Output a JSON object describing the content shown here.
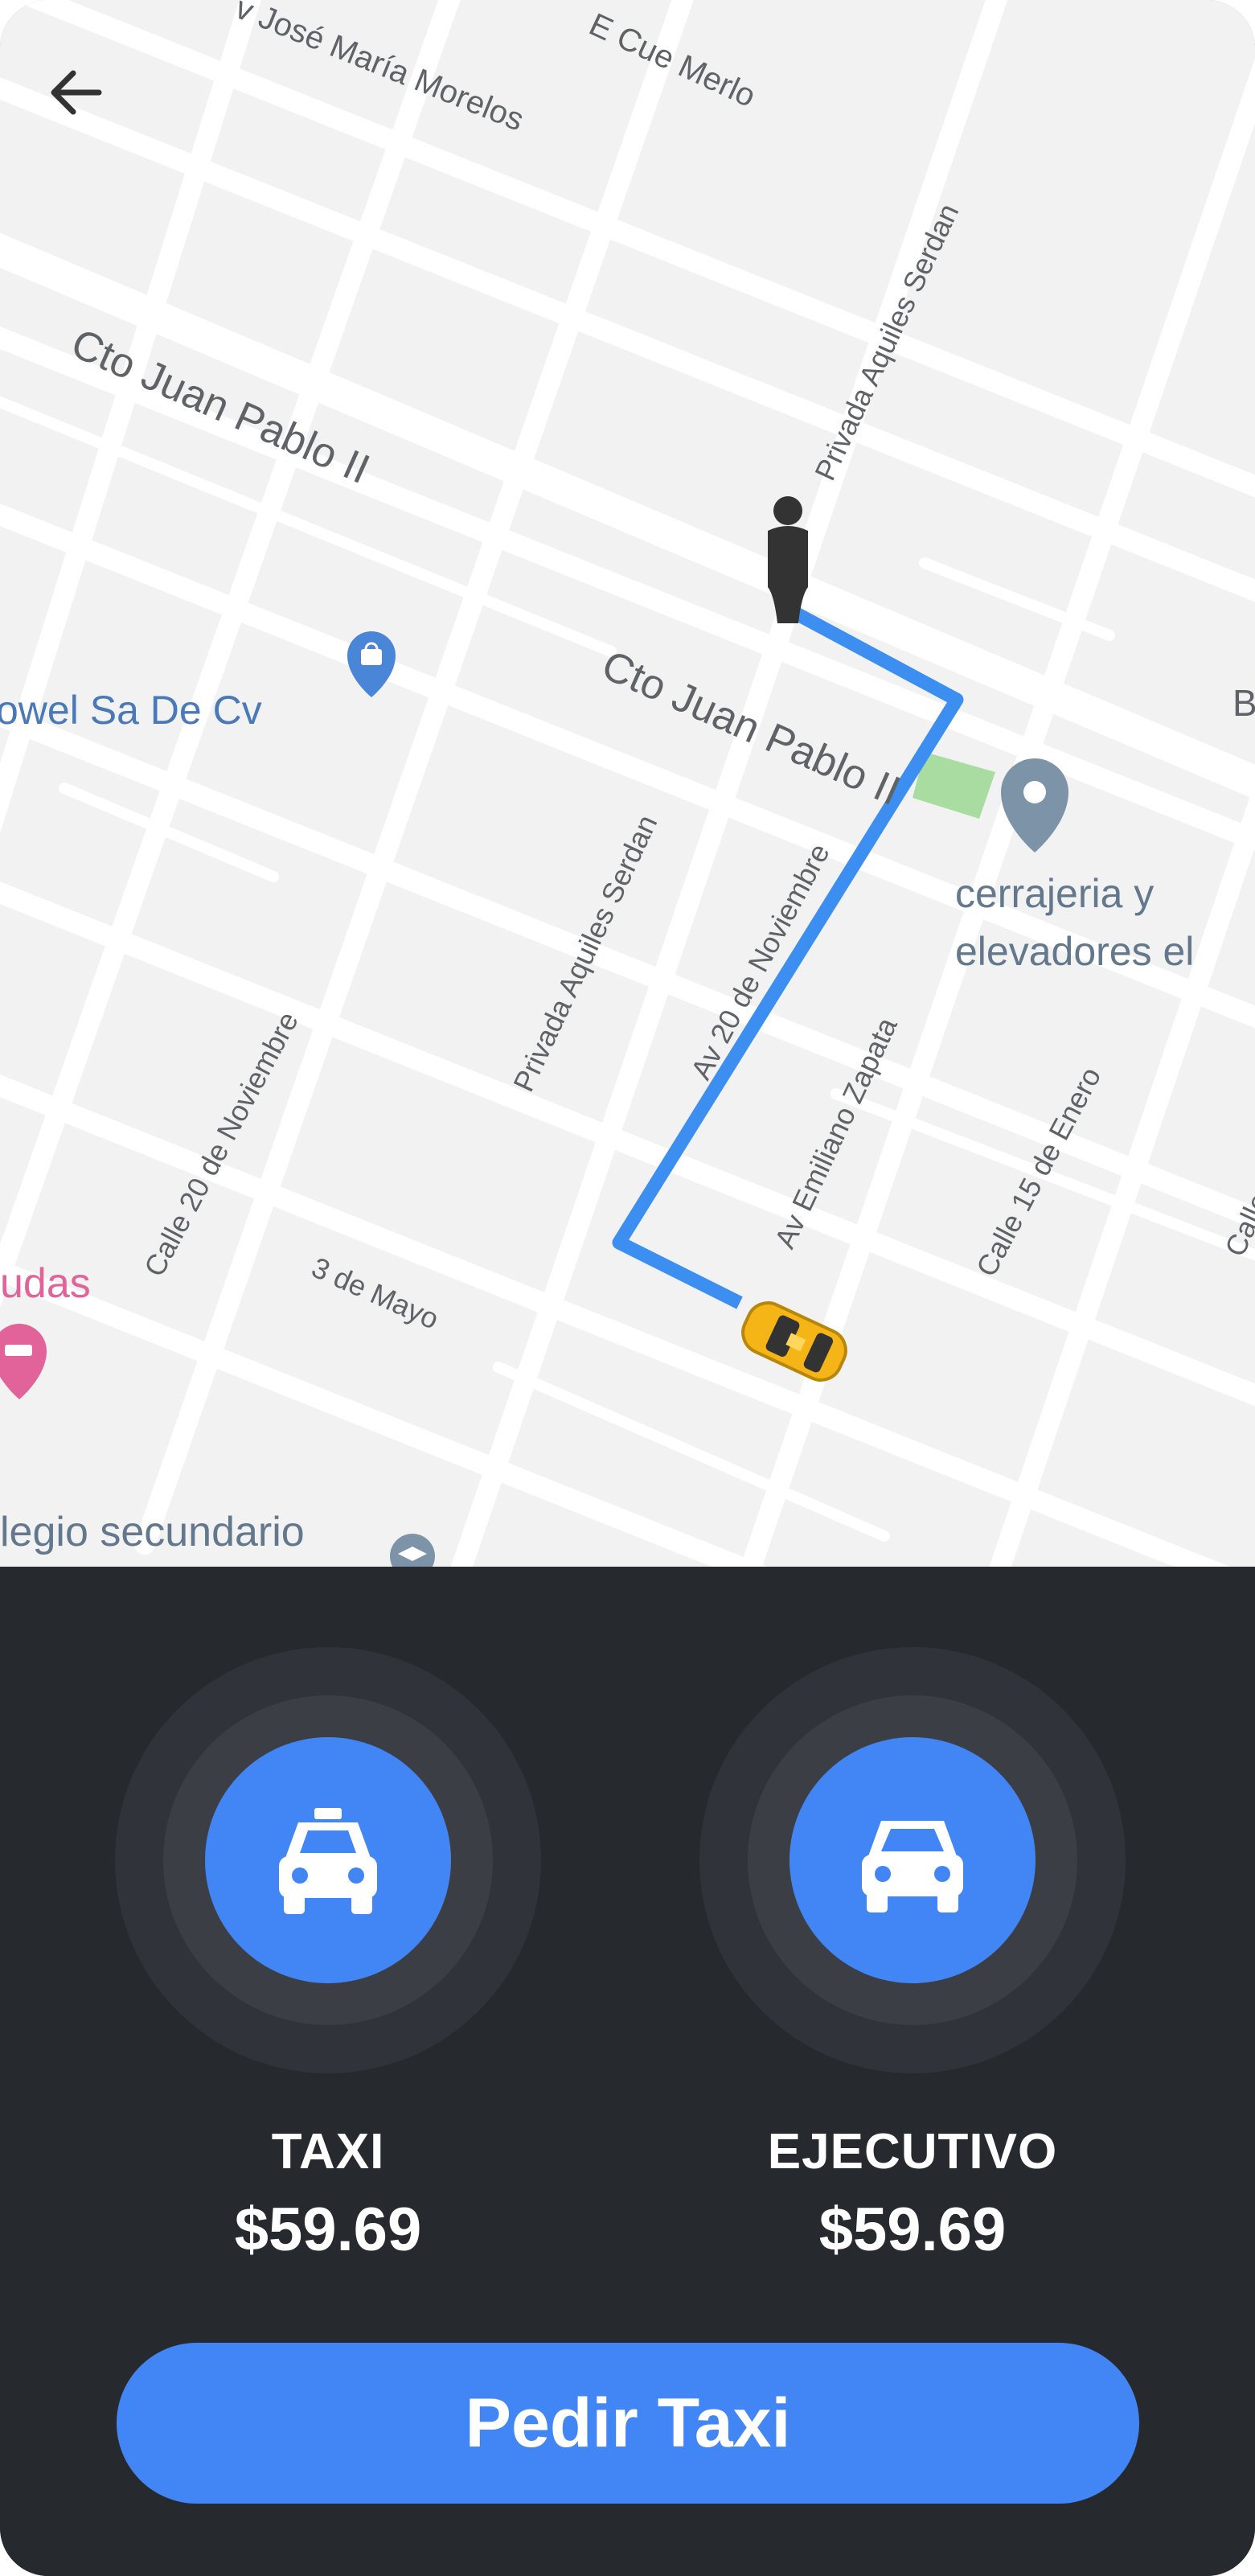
{
  "map": {
    "streets": {
      "morelos": "v José María Morelos",
      "cue_merlo": "E Cue Merlo",
      "juan_pablo_1": "Cto Juan Pablo II",
      "juan_pablo_2": "Cto Juan Pablo II",
      "aquiles_1": "Privada Aquiles Serdan",
      "aquiles_2": "Privada Aquiles Serdan",
      "noviembre_20": "Calle 20 de Noviembre",
      "noviembre_av": "Av 20 de Noviembre",
      "zapata": "Av Emiliano Zapata",
      "enero_15": "Calle 15 de Enero",
      "mayo_3": "3 de Mayo",
      "edge_b": "B",
      "edge_c": "Calle"
    },
    "pois": {
      "shop": "owel Sa De Cv",
      "cerrajeria_1": "cerrajeria y",
      "cerrajeria_2": "elevadores el",
      "pink": "udas",
      "school": "legio secundario"
    },
    "colors": {
      "route": "#3c8ff0",
      "taxi": "#f5b516",
      "person": "#333333"
    },
    "icons": {
      "back": "arrow-left-icon",
      "person": "person-marker-icon",
      "taxi": "taxi-car-icon"
    }
  },
  "options": [
    {
      "name": "TAXI",
      "price": "$59.69",
      "icon": "taxi-icon"
    },
    {
      "name": "EJECUTIVO",
      "price": "$59.69",
      "icon": "car-icon"
    }
  ],
  "cta": {
    "label": "Pedir Taxi"
  },
  "colors": {
    "panel": "#262a2e",
    "accent": "#4286f5"
  }
}
